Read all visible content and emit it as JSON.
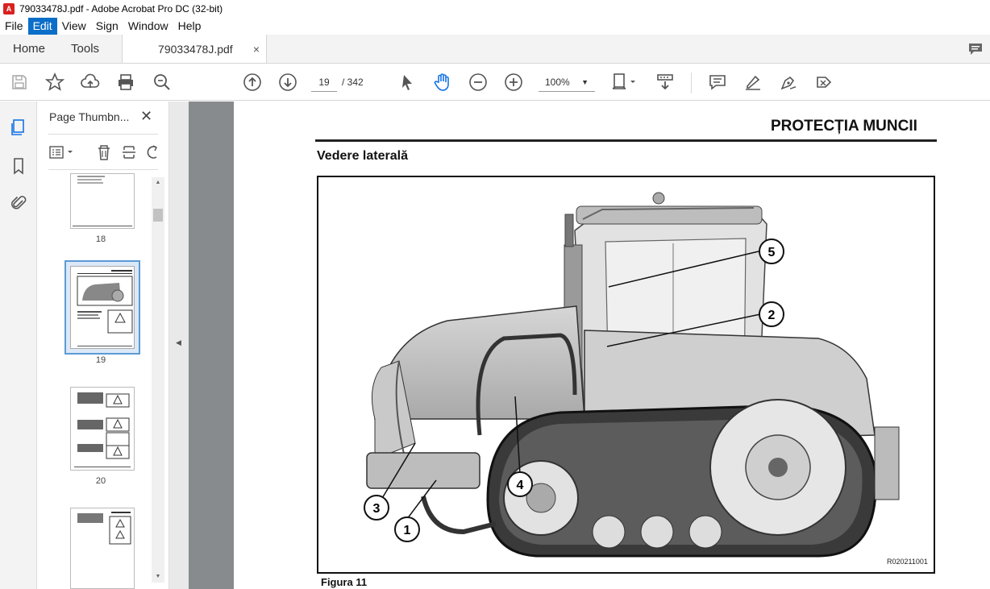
{
  "window": {
    "title": "79033478J.pdf - Adobe Acrobat Pro DC (32-bit)"
  },
  "menu": [
    "File",
    "Edit",
    "View",
    "Sign",
    "Window",
    "Help"
  ],
  "tabs": {
    "home": "Home",
    "tools": "Tools",
    "document": "79033478J.pdf",
    "close": "×"
  },
  "toolbar": {
    "page_current": "19",
    "page_total": "/ 342",
    "zoom": "100%"
  },
  "thumbnails": {
    "title": "Page Thumbn...",
    "pages": [
      {
        "label": "18"
      },
      {
        "label": "19",
        "selected": true
      },
      {
        "label": "20"
      },
      {
        "label": ""
      }
    ]
  },
  "document": {
    "header": "PROTECȚIA MUNCII",
    "subheading": "Vedere laterală",
    "figure_code": "R020211001",
    "figure_caption": "Figura 11",
    "callouts": [
      "1",
      "2",
      "3",
      "4",
      "5"
    ]
  },
  "colors": {
    "accent": "#0b6ec9",
    "selection": "#5b9bd5",
    "viewer_bg": "#888b8e"
  }
}
